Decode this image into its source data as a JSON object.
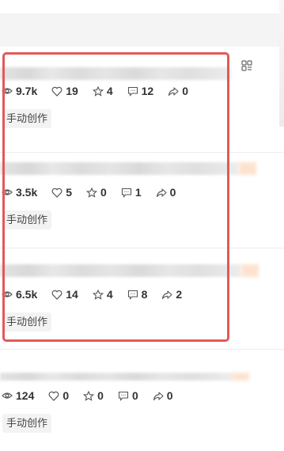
{
  "articles": [
    {
      "stats": {
        "views": "9.7k",
        "likes": "19",
        "favorites": "4",
        "comments": "12",
        "shares": "0"
      },
      "tag": "手动创作"
    },
    {
      "stats": {
        "views": "3.5k",
        "likes": "5",
        "favorites": "0",
        "comments": "1",
        "shares": "0"
      },
      "tag": "手动创作"
    },
    {
      "stats": {
        "views": "6.5k",
        "likes": "14",
        "favorites": "4",
        "comments": "8",
        "shares": "2"
      },
      "tag": "手动创作"
    },
    {
      "stats": {
        "views": "124",
        "likes": "0",
        "favorites": "0",
        "comments": "0",
        "shares": "0"
      },
      "tag": "手动创作"
    }
  ],
  "icons": {
    "views": "eye-icon",
    "likes": "heart-icon",
    "favorites": "star-icon",
    "comments": "comment-icon",
    "shares": "share-icon",
    "layout": "grid-icon"
  },
  "colors": {
    "highlight_border": "#e25a57",
    "tag_background": "#f3f3f3",
    "text": "#333333"
  }
}
